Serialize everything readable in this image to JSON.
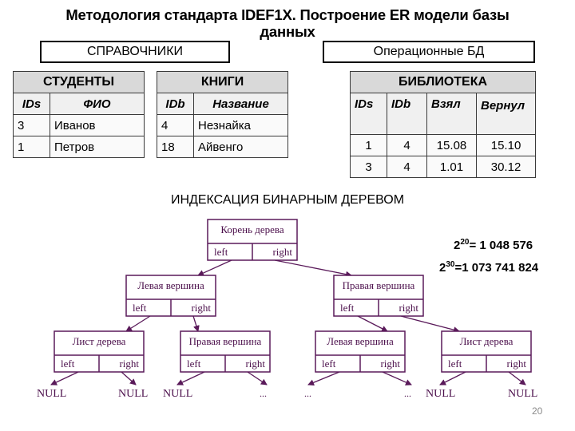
{
  "title": {
    "line1": "Методология стандарта IDEF1X. Построение ER модели базы",
    "line2": "данных"
  },
  "labels": {
    "references": "СПРАВОЧНИКИ",
    "operational": "Операционные БД"
  },
  "tables": {
    "students": {
      "name": "СТУДЕНТЫ",
      "columns": [
        "IDs",
        "ФИО"
      ],
      "rows": [
        [
          "3",
          "Иванов"
        ],
        [
          "1",
          "Петров"
        ]
      ]
    },
    "books": {
      "name": "КНИГИ",
      "columns": [
        "IDb",
        "Название"
      ],
      "rows": [
        [
          "4",
          "Незнайка"
        ],
        [
          "18",
          "Айвенго"
        ]
      ]
    },
    "library": {
      "name": "БИБЛИОТЕКА",
      "columns": [
        "IDs",
        "IDb",
        "Взял",
        "Вернул"
      ],
      "rows": [
        [
          "1",
          "4",
          "15.08",
          "15.10"
        ],
        [
          "3",
          "4",
          "1.01",
          "30.12"
        ]
      ]
    }
  },
  "section_title": "ИНДЕКСАЦИЯ БИНАРНЫМ ДЕРЕВОМ",
  "powers": [
    {
      "base": "2",
      "exp": "20",
      "eq": "= 1 048 576"
    },
    {
      "base": "2",
      "exp": "30",
      "eq": "=1 073 741 824"
    }
  ],
  "tree": {
    "left_label": "left",
    "right_label": "right",
    "nodes": {
      "root": "Корень дерева",
      "left": "Левая вершина",
      "right": "Правая вершина",
      "ll": "Лист дерева",
      "lr": "Правая вершина",
      "rl": "Левая вершина",
      "rr": "Лист дерева"
    },
    "terminals": [
      "NULL",
      "NULL",
      "NULL",
      "...",
      "...",
      "...",
      "NULL",
      "NULL"
    ]
  },
  "colors": {
    "tree_stroke": "#5a1a5a",
    "table_header": "#d9d9d9"
  },
  "page_number": "20"
}
